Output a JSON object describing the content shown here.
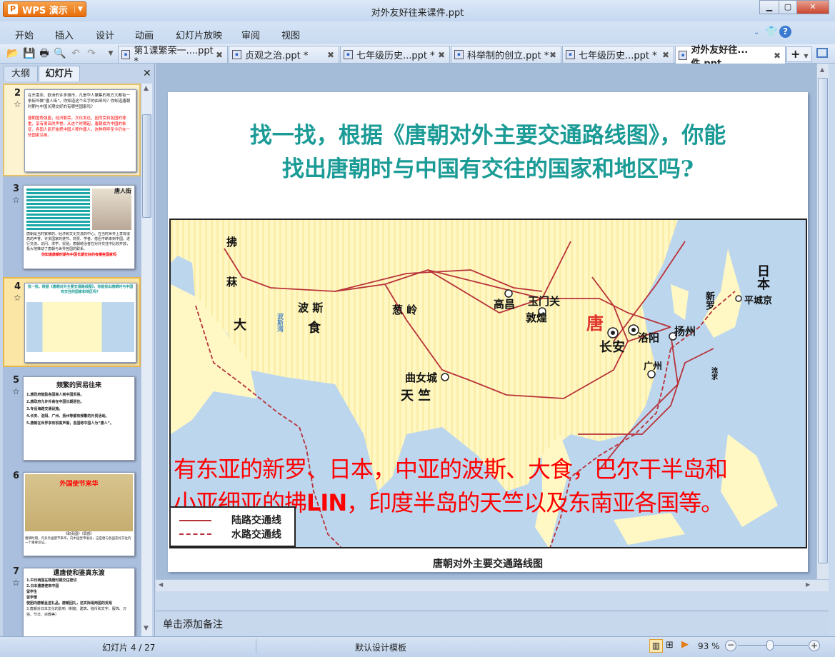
{
  "app": {
    "name": "WPS 演示",
    "window_title": "对外友好往来课件.ppt"
  },
  "menu": [
    "开始",
    "插入",
    "设计",
    "动画",
    "幻灯片放映",
    "审阅",
    "视图"
  ],
  "doc_tabs": [
    {
      "label": "第1课繁荣一....ppt *"
    },
    {
      "label": "贞观之治.ppt *"
    },
    {
      "label": "七年级历史...ppt *"
    },
    {
      "label": "科举制的创立.ppt *"
    },
    {
      "label": "七年级历史...ppt *"
    },
    {
      "label": "对外友好往...件.ppt",
      "active": true
    }
  ],
  "left_pane": {
    "tabs": [
      "大纲",
      "幻灯片"
    ],
    "thumbnails": [
      {
        "num": "2",
        "text": "在东南亚、欧洲的许多城市，凡是华人聚集的地方大都有一条街叫做“唐人街”。你知道这个名字的由来吗？你知道唐朝时期与中国长期交好的有哪些国家吗？",
        "red": "唐朝国势强盛，经济繁荣，文化发达，因而受到各国的尊重，享有很高的声誉。从这个时期起，唐朝成为中国的象征，各国人民开始把中国人称作唐人，这种称呼至今仍在一些国家沿用。"
      },
      {
        "num": "3",
        "text": "唐朝是当时繁荣的、经济和文化交流的中心。在当时世界上享有很高的声誉，许多国家的使节、商贾、学者、僧侣不断来到中国，进行交流、访问、求学、贸易。唐朝统治者在对外交往中比较开放，极大地推动了唐朝与世界各国的联系。",
        "red": "你知道唐朝时期与中国长期交好的有哪些国家吗"
      },
      {
        "num": "4",
        "text": "找一找，根据《唐朝对外主要交通路线图》，你能找出唐朝时与中国有交往的国家和地区吗？"
      },
      {
        "num": "5",
        "title": "频繁的贸易往来",
        "items": [
          "1.唐政府鼓励各国商人到中国贸易。",
          "2.唐政府允许外商在中国长期居住。",
          "3.专设海路交通设施。",
          "4.长安、洛阳、广州、扬州等都有频繁的外贸活动。",
          "5.唐朝在世界享有很高声誉，各国称中国人为“唐人”。"
        ]
      },
      {
        "num": "6",
        "title": "外国使节来华",
        "caption": "《职贡图》（局部）",
        "desc": "唐朝时期，许多外国使节来华，向中国皇帝进贡，这是唐与各国友好交往的一个重要见证。"
      },
      {
        "num": "7",
        "title": "遣唐使和鉴真东渡",
        "items": [
          "1.中日两国在隋唐时期交往密切",
          "2.日本遣唐使来中国",
          "留学生",
          "留学僧",
          "使团向唐朝呈送礼品，唐朝回礼，这实际是两国的贸易",
          "3.唐朝对日本文化的影响（制度、建筑、钱币和文字、服饰、习俗、节日、宗教等）"
        ]
      }
    ]
  },
  "slide": {
    "title_line1": "找一找，根据《唐朝对外主要交通路线图》，你能",
    "title_line2": "找出唐朝时与中国有交往的国家和地区吗?",
    "answer_line1": "有东亚的新罗、日本，中亚的波斯、大食，巴尔干半岛和",
    "answer_line2_a": "小亚细亚的拂",
    "answer_line2_b": "LIN",
    "answer_line2_c": "，印度半岛的天竺以及东南亚各国等。",
    "map_labels": {
      "fu": "拂",
      "lin": "菻",
      "da": "大",
      "shi": "食",
      "bosi": "波 斯",
      "congling": "葱 岭",
      "gaochang": "高昌",
      "yumenguan": "玉门关",
      "dunhuang": "敦煌",
      "tang": "唐",
      "changan": "长安",
      "luoyang": "洛阳",
      "yangzhou": "扬州",
      "xinluo": "新罗",
      "riben": "日本",
      "pingchengjing": "平城京",
      "qunvcheng": "曲女城",
      "tianzhu": "天 竺",
      "guangzhou": "广州",
      "gulf": "波斯湾",
      "liuqiu": "流求"
    },
    "legend": {
      "land": "陆路交通线",
      "sea": "水路交通线"
    },
    "caption": "唐朝对外主要交通路线图",
    "colors": {
      "title": "#1b9b96",
      "answer": "#ff0000",
      "route": "#b8323a",
      "land": "#fff8c4",
      "sea": "#bcd6ee"
    }
  },
  "notes": {
    "placeholder": "单击添加备注"
  },
  "status": {
    "slide_counter": "幻灯片 4 / 27",
    "template": "默认设计模板",
    "zoom": "93 %",
    "zoom_value": 93
  }
}
